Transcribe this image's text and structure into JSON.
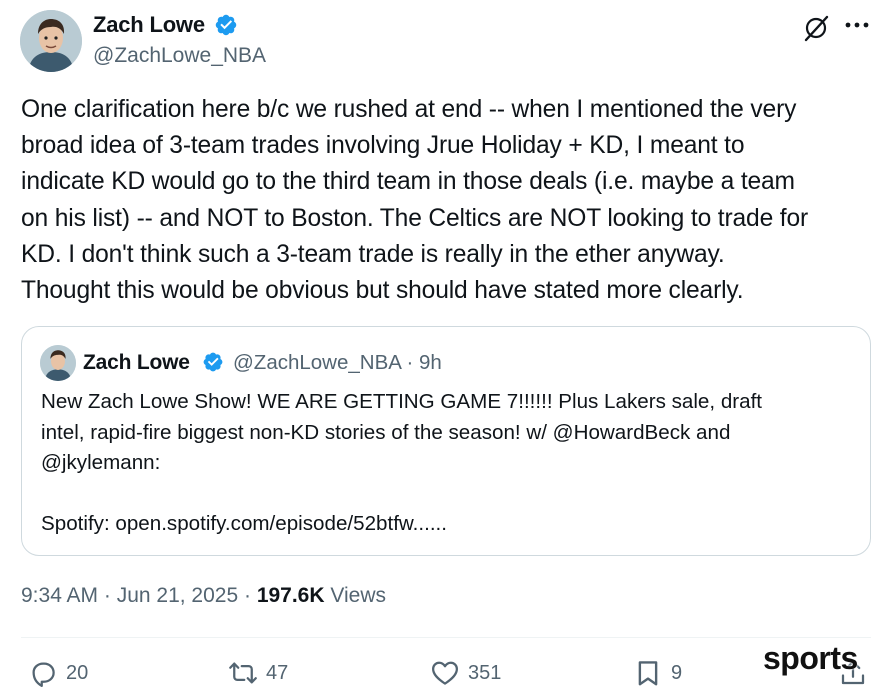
{
  "author": {
    "name": "Zach Lowe",
    "handle": "@ZachLowe_NBA",
    "verified": true
  },
  "tweet": {
    "text": "One clarification here b/c we rushed at end -- when I mentioned the very\nbroad idea of 3-team trades involving Jrue Holiday + KD, I meant to\nindicate KD would go to the third team in those deals (i.e. maybe a team\non his list) -- and NOT to Boston. The Celtics are NOT looking to trade for\nKD. I don't think such a 3-team trade is really in the ether anyway.\nThought this would be obvious but should have stated more clearly."
  },
  "quoted_tweet": {
    "name": "Zach Lowe",
    "handle_time": "@ZachLowe_NBA · 9h",
    "verified": true,
    "text": "New Zach Lowe Show! WE ARE GETTING GAME 7!!!!!! Plus Lakers sale, draft\nintel, rapid-fire biggest non-KD stories of the season! w/ @HowardBeck and\n@jkylemann:\n\nSpotify: open.spotify.com/episode/52btfw......"
  },
  "meta": {
    "timestamp": "9:34 AM · Jun 21, 2025 · ",
    "views_count": "197.6K",
    "views_label": " Views"
  },
  "actions": {
    "replies": "20",
    "reposts": "47",
    "likes": "351",
    "bookmarks": "9"
  },
  "watermark": "sports",
  "colors": {
    "verified_blue": "#1d9bf0",
    "secondary_text": "#536471",
    "border": "#cfd9de"
  },
  "icons": [
    "grok-icon",
    "more-icon",
    "reply-icon",
    "repost-icon",
    "like-icon",
    "bookmark-icon",
    "share-icon",
    "verified-badge-icon"
  ]
}
